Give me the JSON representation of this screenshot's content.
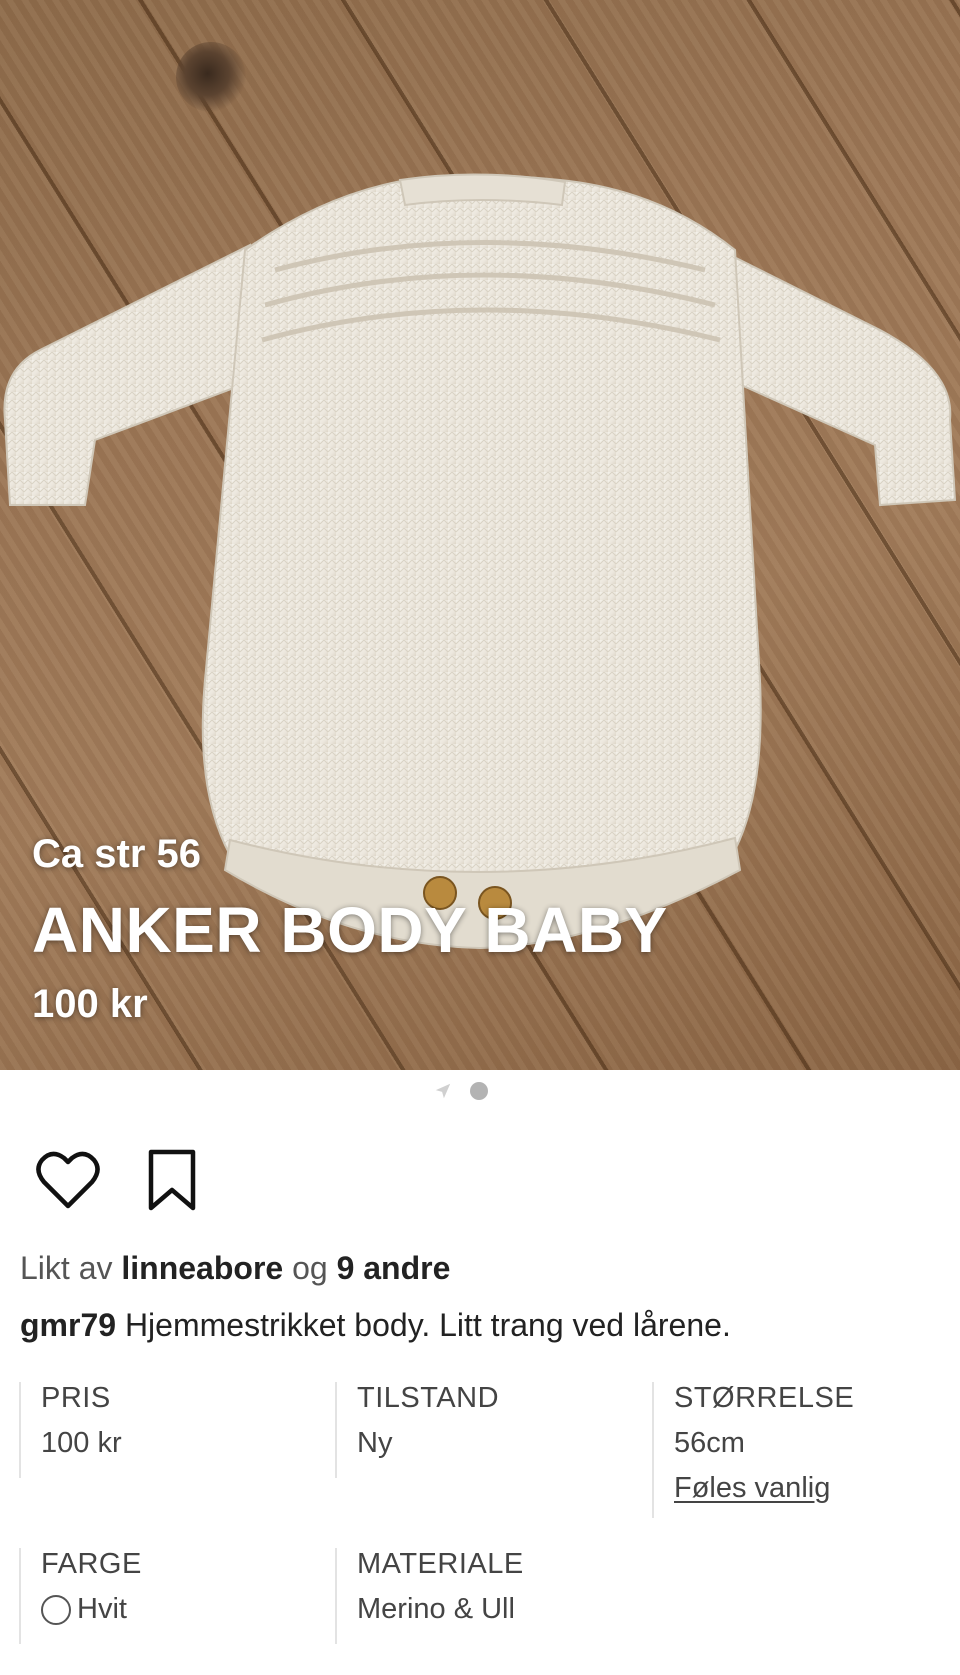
{
  "hero": {
    "subtitle": "Ca str 56",
    "title": "ANKER BODY BABY",
    "price": "100 kr"
  },
  "pager": {
    "total": 1,
    "active": 1
  },
  "actions": {
    "like_icon": "heart-icon",
    "save_icon": "bookmark-icon"
  },
  "likes": {
    "prefix": "Likt av",
    "user": "linneabore",
    "middle": "og",
    "others": "9 andre"
  },
  "caption": {
    "user": "gmr79",
    "text": "Hjemmestrikket body. Litt trang ved lårene."
  },
  "attributes": {
    "price": {
      "label": "PRIS",
      "value": "100 kr"
    },
    "condition": {
      "label": "TILSTAND",
      "value": "Ny"
    },
    "size": {
      "label": "STØRRELSE",
      "value": "56cm",
      "fit_link": "Føles vanlig"
    },
    "color": {
      "label": "FARGE",
      "value": "Hvit",
      "swatch": "#ffffff"
    },
    "material": {
      "label": "MATERIALE",
      "value": "Merino & Ull"
    }
  }
}
